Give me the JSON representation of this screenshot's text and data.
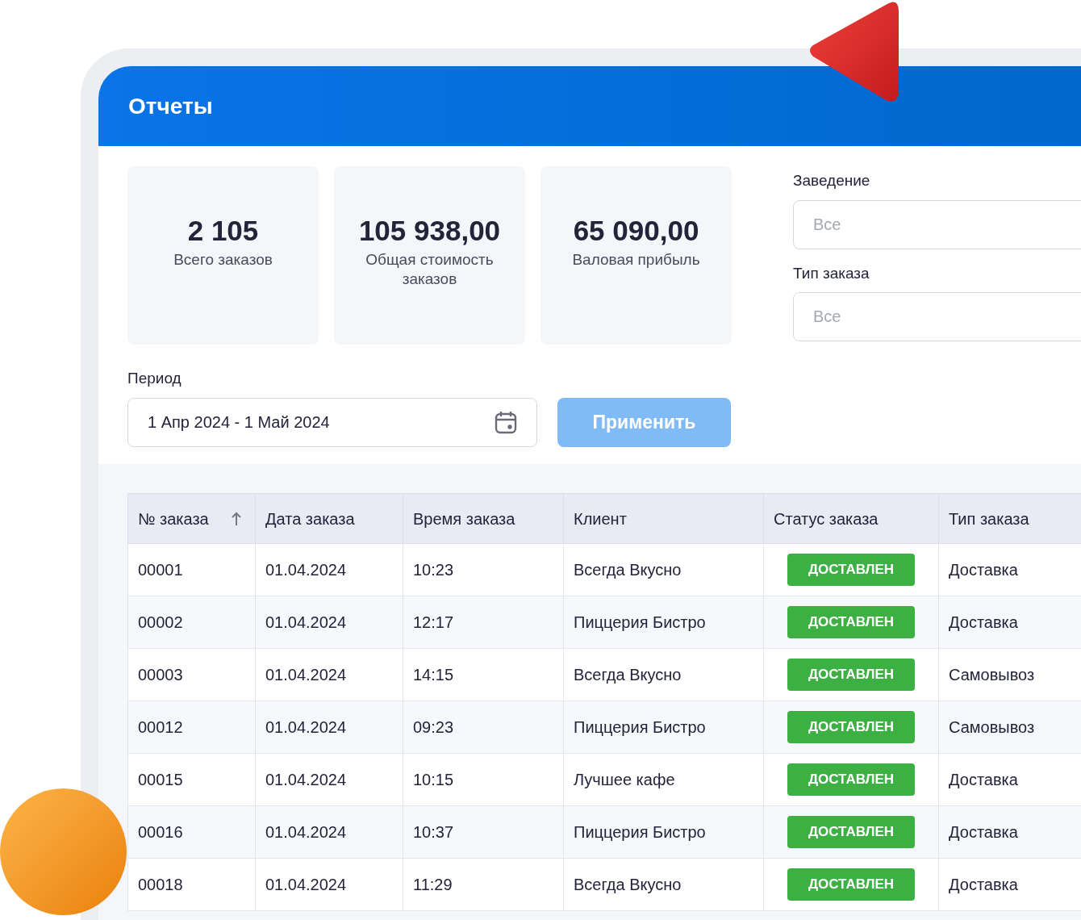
{
  "header": {
    "title": "Отчеты"
  },
  "stats": [
    {
      "value": "2 105",
      "label": "Всего заказов"
    },
    {
      "value": "105 938,00",
      "label": "Общая стоимость заказов"
    },
    {
      "value": "65 090,00",
      "label": "Валовая прибыль"
    }
  ],
  "period": {
    "label": "Период",
    "value": "1 Апр 2024 - 1 Май 2024"
  },
  "apply_button": {
    "label": "Применить",
    "disabled": true
  },
  "filters": [
    {
      "label": "Заведение",
      "placeholder": "Все"
    },
    {
      "label": "Тип заказа",
      "placeholder": "Все"
    }
  ],
  "table": {
    "columns": [
      {
        "label": "№ заказа",
        "sorted": true
      },
      {
        "label": "Дата заказа",
        "sorted": false
      },
      {
        "label": "Время заказа",
        "sorted": false
      },
      {
        "label": "Клиент",
        "sorted": false
      },
      {
        "label": "Статус заказа",
        "sorted": false
      },
      {
        "label": "Тип заказа",
        "sorted": false
      }
    ],
    "rows": [
      {
        "number": "00001",
        "date": "01.04.2024",
        "time": "10:23",
        "client": "Всегда Вкусно",
        "status": "ДОСТАВЛЕН",
        "type": "Доставка"
      },
      {
        "number": "00002",
        "date": "01.04.2024",
        "time": "12:17",
        "client": "Пиццерия Бистро",
        "status": "ДОСТАВЛЕН",
        "type": "Доставка"
      },
      {
        "number": "00003",
        "date": "01.04.2024",
        "time": "14:15",
        "client": "Всегда Вкусно",
        "status": "ДОСТАВЛЕН",
        "type": "Самовывоз"
      },
      {
        "number": "00012",
        "date": "01.04.2024",
        "time": "09:23",
        "client": "Пиццерия Бистро",
        "status": "ДОСТАВЛЕН",
        "type": "Самовывоз"
      },
      {
        "number": "00015",
        "date": "01.04.2024",
        "time": "10:15",
        "client": "Лучшее кафе",
        "status": "ДОСТАВЛЕН",
        "type": "Доставка"
      },
      {
        "number": "00016",
        "date": "01.04.2024",
        "time": "10:37",
        "client": "Пиццерия Бистро",
        "status": "ДОСТАВЛЕН",
        "type": "Доставка"
      },
      {
        "number": "00018",
        "date": "01.04.2024",
        "time": "11:29",
        "client": "Всегда Вкусно",
        "status": "ДОСТАВЛЕН",
        "type": "Доставка"
      }
    ]
  }
}
